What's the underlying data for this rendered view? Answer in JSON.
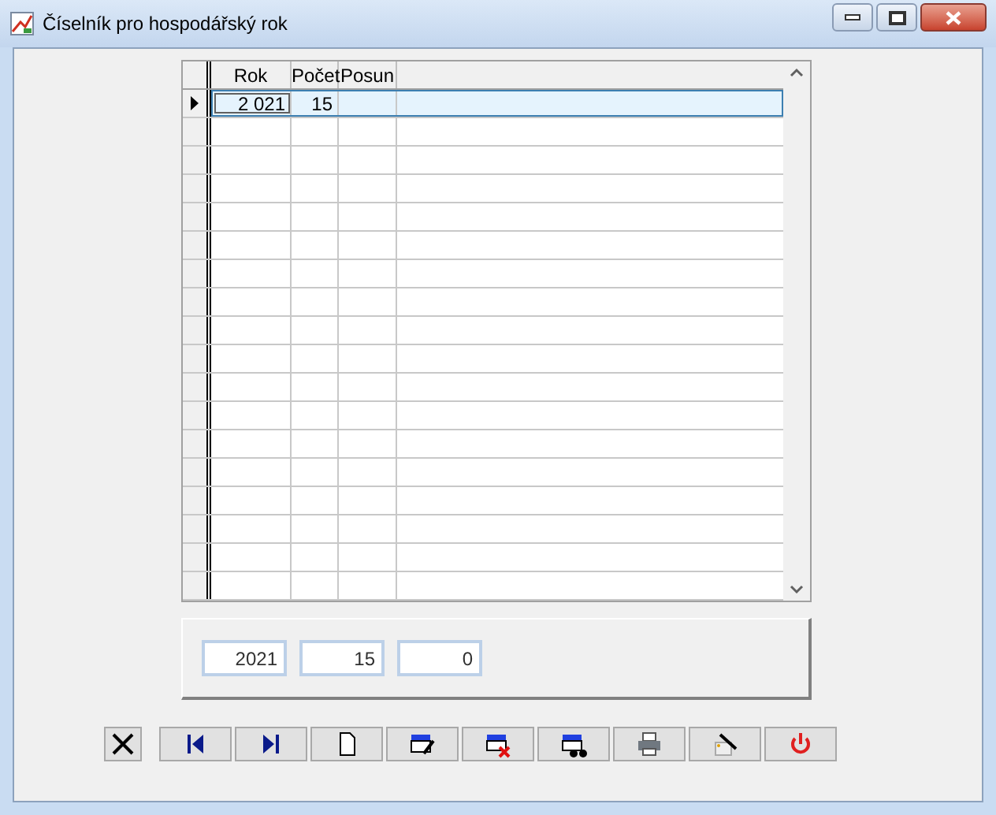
{
  "window": {
    "title": "Číselník pro hospodářský rok"
  },
  "grid": {
    "columns": [
      "Rok",
      "Počet",
      "Posun"
    ],
    "rows": [
      {
        "cells": [
          "2 021",
          "15"
        ],
        "selected": true
      }
    ]
  },
  "fields": [
    {
      "value": "2021"
    },
    {
      "value": "15"
    },
    {
      "value": "0"
    }
  ]
}
